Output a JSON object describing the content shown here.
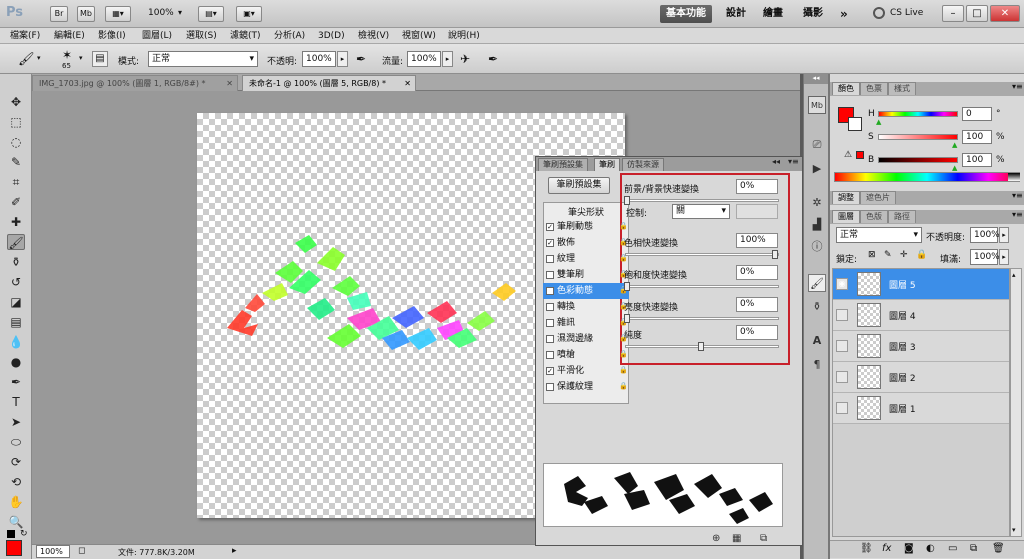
{
  "app": {
    "logo": "Ps",
    "br_label": "Br",
    "mb_label": "Mb",
    "zoom": "100%",
    "workspaces": [
      "基本功能",
      "設計",
      "繪畫",
      "攝影"
    ],
    "more": "»",
    "cs_live": "CS Live"
  },
  "menu": [
    "檔案(F)",
    "編輯(E)",
    "影像(I)",
    "圖層(L)",
    "選取(S)",
    "濾鏡(T)",
    "分析(A)",
    "3D(D)",
    "檢視(V)",
    "視窗(W)",
    "說明(H)"
  ],
  "options": {
    "brush_size": "65",
    "mode_label": "模式:",
    "mode_value": "正常",
    "opacity_label": "不透明:",
    "opacity_value": "100%",
    "flow_label": "流量:",
    "flow_value": "100%"
  },
  "tabs": [
    {
      "label": "IMG_1703.jpg @ 100% (圖層 1, RGB/8#) *",
      "active": false
    },
    {
      "label": "未命名-1 @ 100% (圖層 5, RGB/8) *",
      "active": true
    }
  ],
  "status": {
    "zoom": "100%",
    "file": "文件: 777.8K/3.20M"
  },
  "brush_panel": {
    "tabs": [
      "筆刷預設集",
      "筆刷",
      "仿製來源"
    ],
    "preset_button": "筆刷預設集",
    "tip_shape": "筆尖形狀",
    "items": [
      {
        "label": "筆刷動態",
        "checked": true,
        "active": false
      },
      {
        "label": "散佈",
        "checked": true,
        "active": false
      },
      {
        "label": "紋理",
        "checked": false,
        "active": false
      },
      {
        "label": "雙筆刷",
        "checked": false,
        "active": false
      },
      {
        "label": "色彩動態",
        "checked": true,
        "active": true
      },
      {
        "label": "轉換",
        "checked": false,
        "active": false
      },
      {
        "label": "雜訊",
        "checked": false,
        "active": false
      },
      {
        "label": "濕潤邊緣",
        "checked": false,
        "active": false
      },
      {
        "label": "噴槍",
        "checked": false,
        "active": false
      },
      {
        "label": "平滑化",
        "checked": true,
        "active": false
      },
      {
        "label": "保護紋理",
        "checked": false,
        "active": false
      }
    ],
    "settings": [
      {
        "label": "前景/背景快速變換",
        "value": "0%",
        "pos": 0
      },
      {
        "label": "色相快速變換",
        "value": "100%",
        "pos": 1.0
      },
      {
        "label": "飽和度快速變換",
        "value": "0%",
        "pos": 0
      },
      {
        "label": "亮度快速變換",
        "value": "0%",
        "pos": 0
      },
      {
        "label": "純度",
        "value": "0%",
        "pos": 0.5
      }
    ],
    "control_label": "控制:",
    "control_value": "關"
  },
  "color_panel": {
    "tabs": [
      "顏色",
      "色票",
      "樣式"
    ],
    "rows": [
      {
        "ch": "H",
        "value": "0",
        "unit": "°"
      },
      {
        "ch": "S",
        "value": "100",
        "unit": "%"
      },
      {
        "ch": "B",
        "value": "100",
        "unit": "%"
      }
    ],
    "fg_color": "#ff0000"
  },
  "adjust_tabs": [
    "調整",
    "遮色片"
  ],
  "layers_panel": {
    "tabs": [
      "圖層",
      "色版",
      "路徑"
    ],
    "blend": "正常",
    "opacity_label": "不透明度:",
    "opacity_value": "100%",
    "lock_label": "鎖定:",
    "fill_label": "填滿:",
    "fill_value": "100%",
    "layers": [
      "圖層 5",
      "圖層 4",
      "圖層 3",
      "圖層 2",
      "圖層 1"
    ]
  }
}
